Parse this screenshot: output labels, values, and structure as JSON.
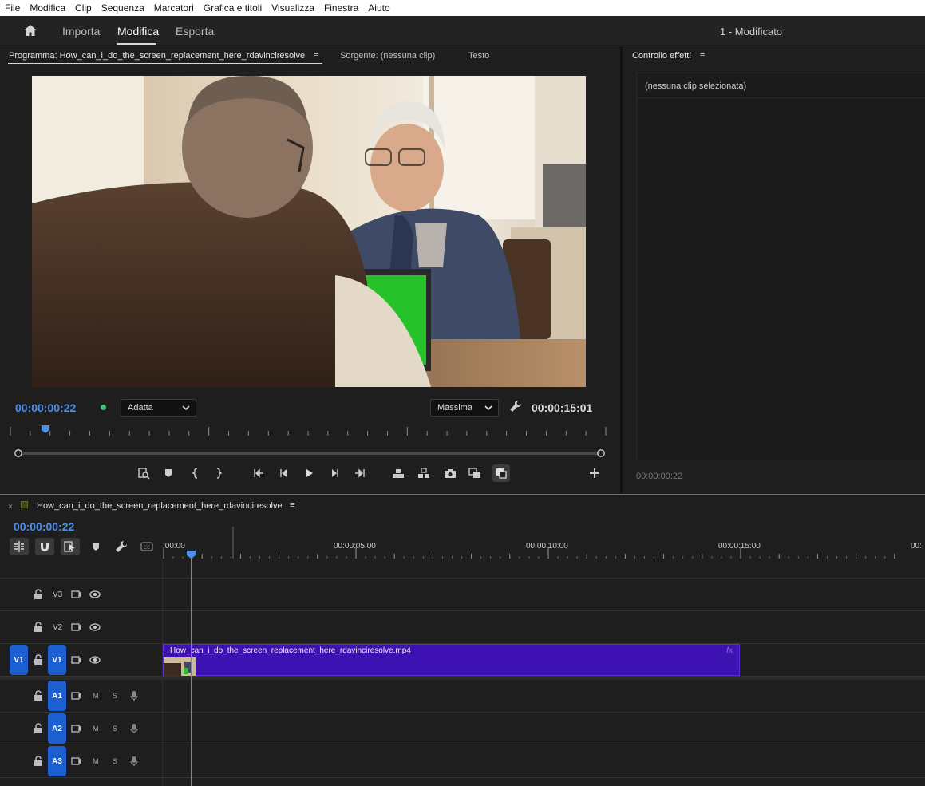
{
  "menubar": [
    "File",
    "Modifica",
    "Clip",
    "Sequenza",
    "Marcatori",
    "Grafica e titoli",
    "Visualizza",
    "Finestra",
    "Aiuto"
  ],
  "header": {
    "tabs": [
      "Importa",
      "Modifica",
      "Esporta"
    ],
    "active_tab": "Modifica",
    "project_title": "1 - Modificato"
  },
  "program_monitor": {
    "tab_program": "Programma: How_can_i_do_the_screen_replacement_here_rdavinciresolve",
    "tab_source": "Sorgente: (nessuna clip)",
    "tab_text": "Testo",
    "menu_glyph": "≡",
    "timecode_current": "00:00:00:22",
    "fit_dropdown": "Adatta",
    "quality_dropdown": "Massima",
    "timecode_duration": "00:00:15:01",
    "playhead_fraction": 0.06
  },
  "effects_panel": {
    "title": "Controllo effetti",
    "menu_glyph": "≡",
    "no_clip_text": "(nessuna clip selezionata)",
    "timecode": "00:00:00:22"
  },
  "timeline": {
    "close_glyph": "×",
    "sequence_name": "How_can_i_do_the_screen_replacement_here_rdavinciresolve",
    "menu_glyph": "≡",
    "timecode": "00:00:00:22",
    "ruler_labels": [
      ":00:00",
      "00:00:05:00",
      "00:00:10:00",
      "00:00:15:00",
      "00:"
    ],
    "video_tracks": [
      {
        "label": "V3"
      },
      {
        "label": "V2"
      },
      {
        "label": "V1",
        "source_patch": "V1",
        "targeted": true
      }
    ],
    "audio_tracks": [
      {
        "label": "A1",
        "mute": "M",
        "solo": "S"
      },
      {
        "label": "A2",
        "mute": "M",
        "solo": "S"
      },
      {
        "label": "A3",
        "mute": "M",
        "solo": "S"
      }
    ],
    "clip": {
      "name": "How_can_i_do_the_screen_replacement_here_rdavinciresolve.mp4",
      "fx_badge": "fx",
      "color": "#3e12b2"
    }
  },
  "colors": {
    "accent_timecode": "#4c8ee8",
    "track_target": "#1b5fd0",
    "clip": "#3e12b2",
    "green_screen": "#25c22a"
  }
}
